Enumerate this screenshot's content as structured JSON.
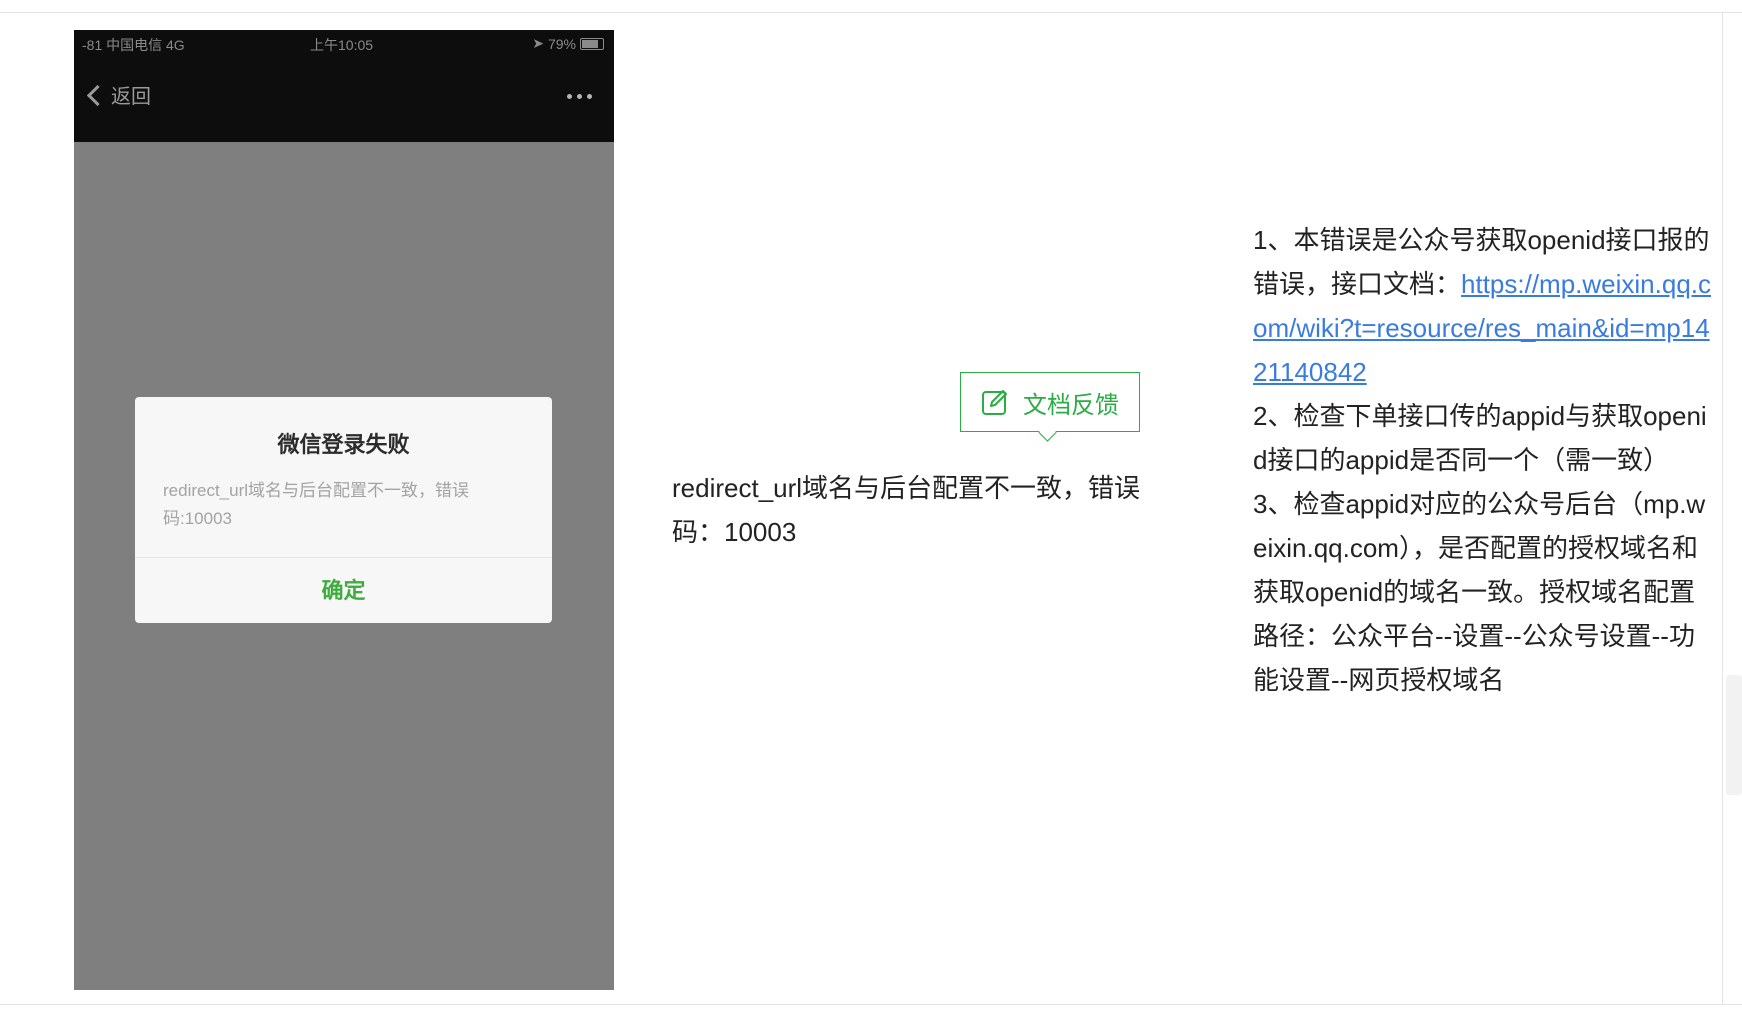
{
  "phone": {
    "status": {
      "carrier": "-81 中国电信  4G",
      "time": "上午10:05",
      "battery": "79%"
    },
    "nav": {
      "back_label": "返回"
    },
    "dialog": {
      "title": "微信登录失败",
      "message": "redirect_url域名与后台配置不一致，错误码:10003",
      "ok_label": "确定"
    }
  },
  "feedback": {
    "label": "文档反馈"
  },
  "error": {
    "text": "redirect_url域名与后台配置不一致，错误码：10003"
  },
  "solution": {
    "item1_text": "1、本错误是公众号获取openid接口报的错误，接口文档：",
    "item1_link": "https://mp.weixin.qq.com/wiki?t=resource/res_main&id=mp1421140842",
    "item2": "2、检查下单接口传的appid与获取openid接口的appid是否同一个（需一致）",
    "item3": "3、检查appid对应的公众号后台（mp.weixin.qq.com），是否配置的授权域名和获取openid的域名一致。授权域名配置路径：公众平台--设置--公众号设置--功能设置--网页授权域名"
  },
  "colors": {
    "accent_green": "#2bad45",
    "link_blue": "#3a7be0",
    "dialog_ok_green": "#3ead3e"
  }
}
